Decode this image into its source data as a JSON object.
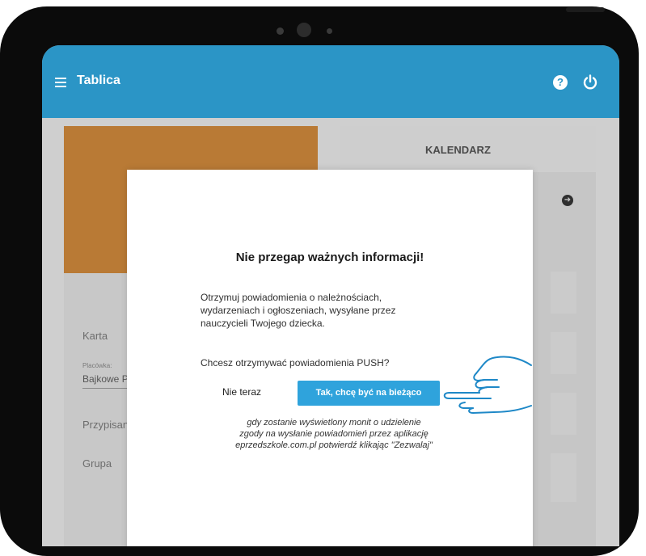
{
  "appbar": {
    "title": "Tablica",
    "help_icon": "question-circle-icon",
    "power_icon": "power-icon",
    "menu_icon": "hamburger-menu-icon",
    "color": "#2b95c6"
  },
  "left_card": {
    "accent": "#b97a35",
    "karta_label": "Karta",
    "placowka_label": "Placówka:",
    "placowka_value": "Bajkowe P",
    "przypisanie_label": "Przypisan",
    "grupa_label": "Grupa"
  },
  "right_card": {
    "title": "KALENDARZ",
    "arrow_icon": "arrow-right-circle-icon"
  },
  "dialog": {
    "heading": "Nie przegap ważnych informacji!",
    "body": "Otrzymuj powiadomienia o należnościach, wydarzeniach i ogłoszeniach, wysyłane przez nauczycieli Twojego dziecka.",
    "question": "Chcesz otrzymywać powiadomienia PUSH?",
    "no_label": "Nie teraz",
    "yes_label": "Tak, chcę być na bieżąco",
    "yes_color": "#2fa3dc",
    "note": "gdy zostanie wyświetlony monit o udzielenie zgody na wysłanie powiadomień przez aplikację eprzedszkole.com.pl potwierdź klikając \"Zezwalaj\""
  },
  "pointer": {
    "icon": "pointing-hand-icon",
    "color": "#1e88c7"
  }
}
